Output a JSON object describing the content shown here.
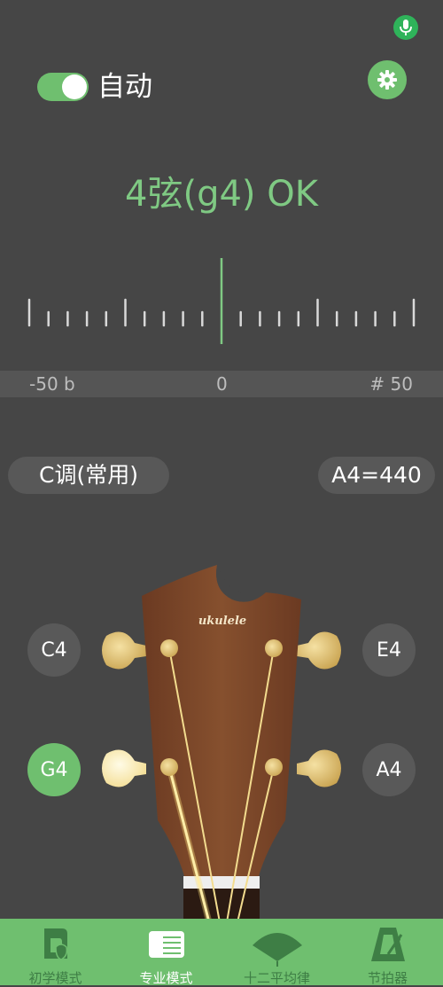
{
  "auto": {
    "label": "自动",
    "enabled": true
  },
  "status": {
    "text": "4弦(g4) OK",
    "color": "#7fc983"
  },
  "meter": {
    "min_label": "-50 b",
    "mid_label": "0",
    "max_label": "# 50",
    "cents": 0
  },
  "key": {
    "label": "C调(常用)"
  },
  "reference": {
    "label": "A4=440"
  },
  "headstock": {
    "brand": "ukulele",
    "color": "#7a4428"
  },
  "strings": [
    {
      "note": "C4",
      "active": false
    },
    {
      "note": "E4",
      "active": false
    },
    {
      "note": "G4",
      "active": true
    },
    {
      "note": "A4",
      "active": false
    }
  ],
  "nav": [
    {
      "label": "初学模式",
      "icon": "beginner-mode-icon",
      "active": false
    },
    {
      "label": "专业模式",
      "icon": "pro-mode-icon",
      "active": true
    },
    {
      "label": "十二平均律",
      "icon": "equal-temperament-icon",
      "active": false
    },
    {
      "label": "节拍器",
      "icon": "metronome-icon",
      "active": false
    }
  ],
  "colors": {
    "accent": "#6fbf6f",
    "background": "#464646",
    "mic": "#2fb35a"
  }
}
